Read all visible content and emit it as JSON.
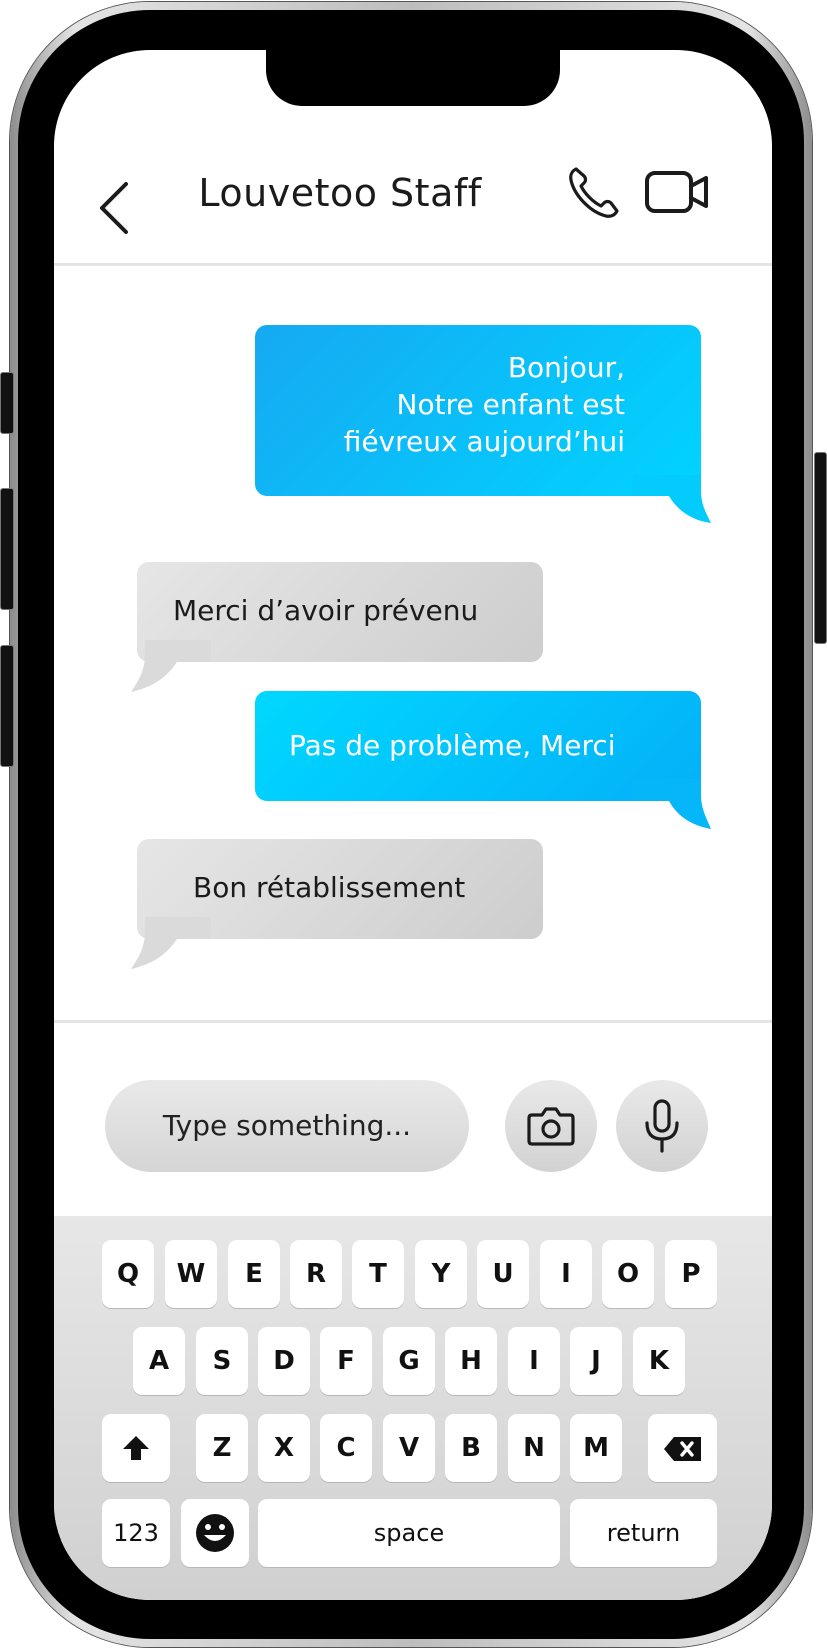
{
  "header": {
    "title": "Louvetoo Staff"
  },
  "messages": [
    {
      "direction": "sent",
      "lines": [
        "Bonjour,",
        "Notre enfant est",
        "fiévreux aujourd’hui"
      ]
    },
    {
      "direction": "received",
      "text": "Merci d’avoir prévenu"
    },
    {
      "direction": "sent",
      "text": "Pas de problème, Merci"
    },
    {
      "direction": "received",
      "text": "Bon rétablissement"
    }
  ],
  "composer": {
    "placeholder": "Type something..."
  },
  "keyboard": {
    "row1": [
      "Q",
      "W",
      "E",
      "R",
      "T",
      "Y",
      "U",
      "I",
      "O",
      "P"
    ],
    "row2": [
      "A",
      "S",
      "D",
      "F",
      "G",
      "H",
      "I",
      "J",
      "K"
    ],
    "row3": [
      "Z",
      "X",
      "C",
      "V",
      "B",
      "N",
      "M"
    ],
    "numbers_label": "123",
    "space_label": "space",
    "return_label": "return"
  },
  "colors": {
    "sent_bubble": "#16a9f2",
    "sent_bubble_light": "#00d4ff",
    "received_bubble": "#dcdcdc"
  },
  "icons": {
    "back": "chevron-left-icon",
    "call": "phone-icon",
    "video": "video-camera-icon",
    "camera": "camera-icon",
    "mic": "microphone-icon",
    "shift": "shift-arrow-icon",
    "delete": "backspace-icon",
    "emoji": "emoji-smiley-icon"
  }
}
